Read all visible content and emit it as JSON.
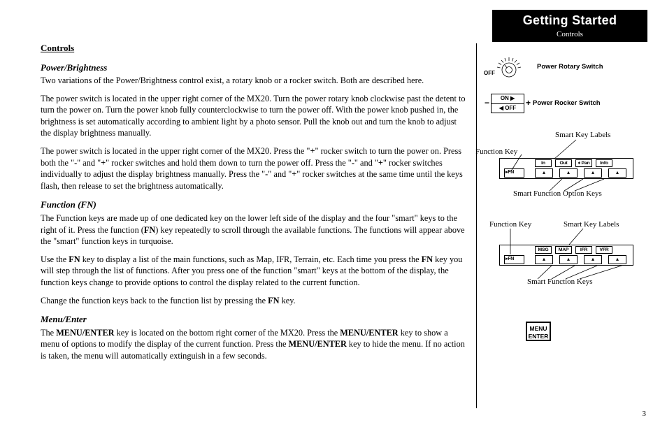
{
  "header": {
    "title": "Getting Started",
    "subtitle": "Controls"
  },
  "body": {
    "controls_heading": "Controls",
    "power_heading": "Power/Brightness",
    "power_p1": "Two variations of the Power/Brightness control exist, a rotary knob or a rocker switch. Both are described here.",
    "power_p2": "The power switch is located in the upper right corner of the MX20. Turn the power rotary knob clockwise past the detent to turn the power on. Turn the power knob fully counterclockwise to turn the power off. With the power knob pushed in, the brightness is set automatically according to ambient light by a photo sensor. Pull the knob out and turn the knob to adjust the display brightness manually.",
    "power_p3_a": "The power switch is located in the upper right corner of the MX20. Press the \"",
    "power_p3_b": "\" rocker switch to turn the power on. Press both the \"",
    "power_p3_c": "\" and \"",
    "power_p3_d": "\" rocker switches and hold them down to turn the power off. Press the \"",
    "power_p3_e": "\" and \"",
    "power_p3_f": "\" rocker switches individually to adjust the display brightness manually. Press the \"",
    "power_p3_g": "\" and \"",
    "power_p3_h": "\" rocker switches at the same time until the keys flash, then release to set the brightness automatically.",
    "plus": "+",
    "minus": "-",
    "fn_heading": "Function (FN)",
    "fn_p1_a": "The Function keys are made up of one dedicated key on the lower left side of the display and the four \"smart\" keys to the right of it. Press the function (",
    "fn_p1_b": ") key repeatedly to scroll through the available functions. The functions will appear above the \"smart\" function keys in turquoise.",
    "fn_bold": "FN",
    "fn_p2_a": "Use the ",
    "fn_p2_b": " key to display a list of the main functions, such as Map, IFR, Terrain, etc. Each time you press the ",
    "fn_p2_c": " key you will step through the list of functions. After you press one of the function \"smart\" keys at the bottom of the display, the function keys change to provide options to control the display related to the current function.",
    "fn_p3_a": "Change the function keys back to the function list by pressing the ",
    "fn_p3_b": " key.",
    "menu_heading": "Menu/Enter",
    "menu_p1_a": "The ",
    "menu_p1_b": " key is located on the bottom right corner of the MX20. Press the ",
    "menu_p1_c": " key to show a menu of options to modify the display of the current function. Press the ",
    "menu_p1_d": " key to hide the menu. If no action is taken, the menu will automatically extinguish in a few seconds.",
    "menu_enter_bold": "MENU/ENTER"
  },
  "side": {
    "rotary_off": "OFF",
    "rotary_label": "Power Rotary Switch",
    "rocker_on": "ON ▶",
    "rocker_off": "◀ OFF",
    "rocker_minus": "−",
    "rocker_plus": "+",
    "rocker_label": "Power Rocker Switch",
    "smart_key_labels": "Smart Key Labels",
    "function_key": "Function Key",
    "smart_fn_option_keys": "Smart Function Option Keys",
    "smart_fn_keys": "Smart Function Keys",
    "fn_key": "▸FN",
    "tri": "▴",
    "panel1_labels": {
      "a": "In",
      "b": "Out",
      "c": "♦ Pan",
      "d": "Info"
    },
    "panel2_labels": {
      "a": "MSG",
      "b": "MAP",
      "c": "IFR",
      "d": "VFR"
    },
    "menu_btn_l1": "MENU",
    "menu_btn_l2": "ENTER"
  },
  "page_number": "3"
}
